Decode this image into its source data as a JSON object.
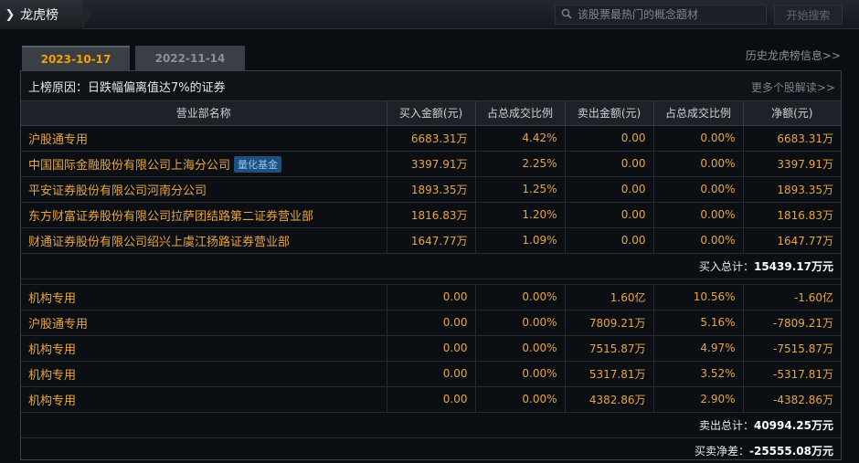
{
  "header": {
    "title": "龙虎榜",
    "search_placeholder": "该股票最热门的概念题材",
    "search_button": "开始搜索"
  },
  "tabs": [
    {
      "label": "2023-10-17",
      "active": true
    },
    {
      "label": "2022-11-14",
      "active": false
    }
  ],
  "history_link": "历史龙虎榜信息>>",
  "reason": {
    "label": "上榜原因：",
    "value": "日跌幅偏离值达7%的证券",
    "more_link": "更多个股解读>>"
  },
  "table": {
    "columns": [
      "营业部名称",
      "买入金额(元)",
      "占总成交比例",
      "卖出金额(元)",
      "占总成交比例",
      "净额(元)"
    ],
    "buy_rows": [
      {
        "name": "沪股通专用",
        "badge": "",
        "buy": "6683.31万",
        "buy_pct": "4.42%",
        "sell": "0.00",
        "sell_pct": "0.00%",
        "net": "6683.31万"
      },
      {
        "name": "中国国际金融股份有限公司上海分公司",
        "badge": "量化基金",
        "buy": "3397.91万",
        "buy_pct": "2.25%",
        "sell": "0.00",
        "sell_pct": "0.00%",
        "net": "3397.91万"
      },
      {
        "name": "平安证券股份有限公司河南分公司",
        "badge": "",
        "buy": "1893.35万",
        "buy_pct": "1.25%",
        "sell": "0.00",
        "sell_pct": "0.00%",
        "net": "1893.35万"
      },
      {
        "name": "东方财富证券股份有限公司拉萨团结路第二证券营业部",
        "badge": "",
        "buy": "1816.83万",
        "buy_pct": "1.20%",
        "sell": "0.00",
        "sell_pct": "0.00%",
        "net": "1816.83万"
      },
      {
        "name": "财通证券股份有限公司绍兴上虞江扬路证券营业部",
        "badge": "",
        "buy": "1647.77万",
        "buy_pct": "1.09%",
        "sell": "0.00",
        "sell_pct": "0.00%",
        "net": "1647.77万"
      }
    ],
    "buy_total_label": "买入总计：",
    "buy_total_value": "15439.17万元",
    "sell_rows": [
      {
        "name": "机构专用",
        "badge": "",
        "buy": "0.00",
        "buy_pct": "0.00%",
        "sell": "1.60亿",
        "sell_pct": "10.56%",
        "net": "-1.60亿"
      },
      {
        "name": "沪股通专用",
        "badge": "",
        "buy": "0.00",
        "buy_pct": "0.00%",
        "sell": "7809.21万",
        "sell_pct": "5.16%",
        "net": "-7809.21万"
      },
      {
        "name": "机构专用",
        "badge": "",
        "buy": "0.00",
        "buy_pct": "0.00%",
        "sell": "7515.87万",
        "sell_pct": "4.97%",
        "net": "-7515.87万"
      },
      {
        "name": "机构专用",
        "badge": "",
        "buy": "0.00",
        "buy_pct": "0.00%",
        "sell": "5317.81万",
        "sell_pct": "3.52%",
        "net": "-5317.81万"
      },
      {
        "name": "机构专用",
        "badge": "",
        "buy": "0.00",
        "buy_pct": "0.00%",
        "sell": "4382.86万",
        "sell_pct": "2.90%",
        "net": "-4382.86万"
      }
    ],
    "sell_total_label": "卖出总计：",
    "sell_total_value": "40994.25万元",
    "net_label": "买卖净差：",
    "net_value": "-25555.08万元"
  }
}
